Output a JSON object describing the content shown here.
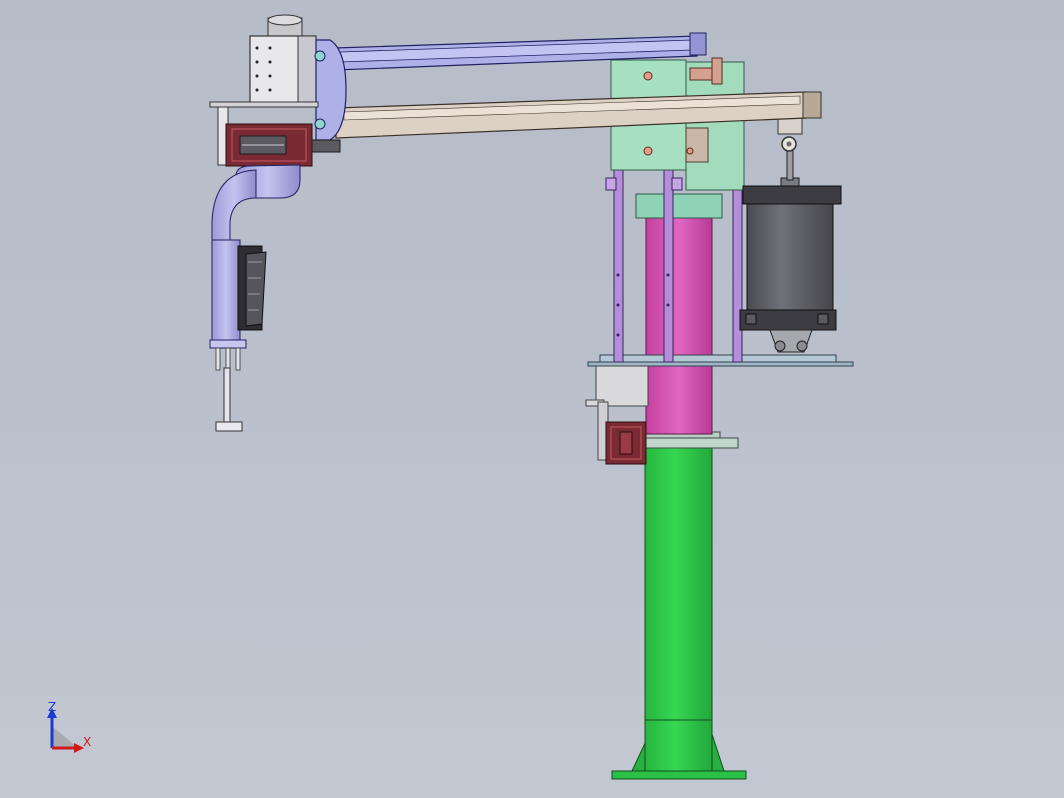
{
  "viewport": {
    "background_top": "#b6bdc9",
    "background_bottom": "#c3c8d2"
  },
  "colors": {
    "column": "#2ec94a",
    "rotating_sleeve": "#d856b8",
    "cylinder": "#5c5c62",
    "mounting_plate": "#a7e0c0",
    "upper_arm": "#aeb0e8",
    "lower_arm": "#ddd0c4",
    "bent_tube": "#a9a9e4",
    "brackets": "#b48ed8",
    "brake_blocks": "#7a2a32"
  },
  "triad": {
    "z_label": "Z",
    "x_label": "X",
    "z_color": "#1a3ad0",
    "x_color": "#d01a1a"
  }
}
